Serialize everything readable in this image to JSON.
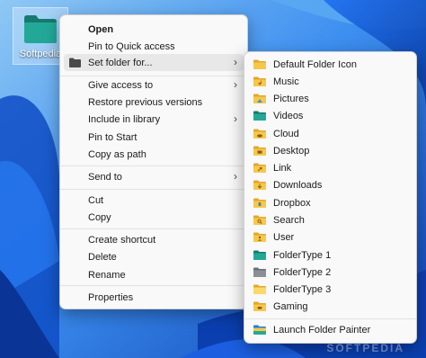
{
  "colors": {
    "menu_bg": "#f9f9f9",
    "hover_bg": "#e8e8e8",
    "folder_yellow": "#f6c84a",
    "folder_teal": "#1f9b8e",
    "folder_gray": "#8a8f96",
    "wallpaper_blue": "#1a6fdc"
  },
  "desktop": {
    "icon_label": "Softpedia",
    "icon": "teal-folder-icon"
  },
  "context_menu": {
    "items": [
      {
        "label": "Open",
        "bold": true
      },
      {
        "label": "Pin to Quick access"
      },
      {
        "label": "Set folder for...",
        "icon": "dark-folder-icon",
        "submenu": true,
        "hover": true
      },
      {
        "label": "Give access to",
        "submenu": true
      },
      {
        "label": "Restore previous versions"
      },
      {
        "label": "Include in library",
        "submenu": true
      },
      {
        "label": "Pin to Start"
      },
      {
        "label": "Copy as path"
      },
      {
        "label": "Send to",
        "submenu": true
      },
      {
        "label": "Cut"
      },
      {
        "label": "Copy"
      },
      {
        "label": "Create shortcut"
      },
      {
        "label": "Delete"
      },
      {
        "label": "Rename"
      },
      {
        "label": "Properties"
      }
    ]
  },
  "submenu": {
    "items": [
      {
        "label": "Default Folder Icon",
        "icon": "default-folder-icon"
      },
      {
        "label": "Music",
        "icon": "music-folder-icon"
      },
      {
        "label": "Pictures",
        "icon": "pictures-folder-icon"
      },
      {
        "label": "Videos",
        "icon": "videos-folder-icon"
      },
      {
        "label": "Cloud",
        "icon": "cloud-folder-icon"
      },
      {
        "label": "Desktop",
        "icon": "desktop-folder-icon"
      },
      {
        "label": "Link",
        "icon": "link-folder-icon"
      },
      {
        "label": "Downloads",
        "icon": "downloads-folder-icon"
      },
      {
        "label": "Dropbox",
        "icon": "dropbox-folder-icon"
      },
      {
        "label": "Search",
        "icon": "search-folder-icon"
      },
      {
        "label": "User",
        "icon": "user-folder-icon"
      },
      {
        "label": "FolderType 1",
        "icon": "teal-folder-icon"
      },
      {
        "label": "FolderType 2",
        "icon": "gray-folder-icon"
      },
      {
        "label": "FolderType 3",
        "icon": "yellow-folder-icon"
      },
      {
        "label": "Gaming",
        "icon": "gaming-folder-icon"
      },
      {
        "label": "Launch Folder Painter",
        "icon": "folder-painter-icon"
      }
    ]
  },
  "watermark": "SOFTPEDIA"
}
